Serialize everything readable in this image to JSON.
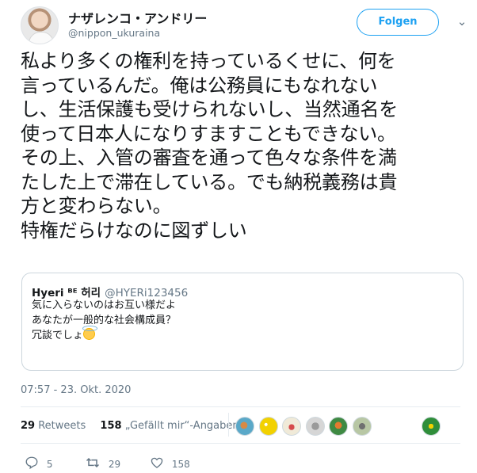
{
  "author": {
    "display_name": "ナザレンコ・アンドリー",
    "handle": "@nippon_ukuraina"
  },
  "follow_label": "Folgen",
  "tweet_text": "私より多くの権利を持っているくせに、何を\n言っているんだ。俺は公務員にもなれない\nし、生活保護も受けられないし、当然通名を\n使って日本人になりすますこともできない。\nその上、入管の審査を通って色々な条件を満\nたした上で滞在している。でも納税義務は貴\n方と変わらない。\n特権だらけなのに図ずしい",
  "quoted_tweet": {
    "display_name": "Ηyeri ᴮᴱ 허리",
    "handle": "@HYERi123456",
    "text": "気に入らないのはお互い様だよ\nあなたが一般的な社会構成員？\n冗談でしょ"
  },
  "timestamp": "07:57 - 23. Okt. 2020",
  "stats": {
    "retweets_count": "29",
    "retweets_label": "Retweets",
    "likes_count": "158",
    "likes_label": "„Gefällt mir“-Angaben"
  },
  "actions": {
    "reply_count": "5",
    "retweet_count": "29",
    "like_count": "158"
  },
  "colors": {
    "accent": "#1da1f2",
    "text_secondary": "#657786",
    "border": "#ccd6dd"
  }
}
